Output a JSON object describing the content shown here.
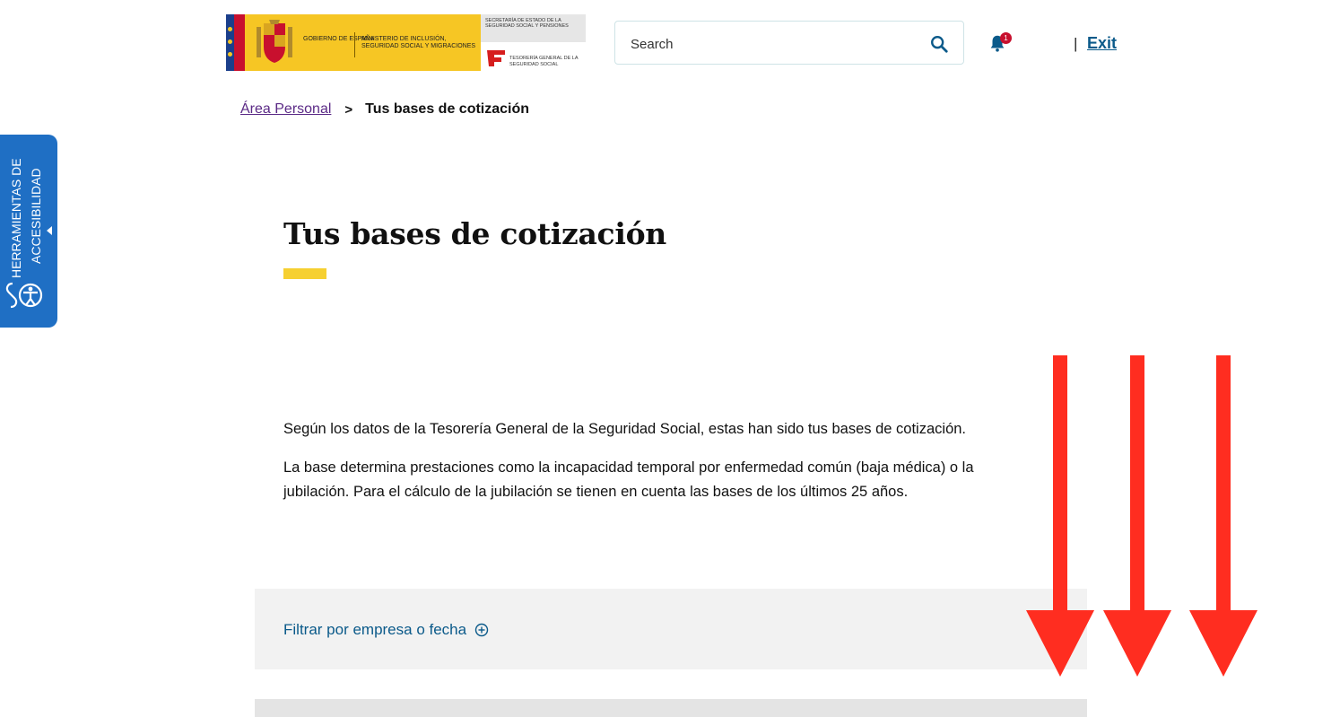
{
  "header": {
    "logo": {
      "gov_line": "Gobierno de España",
      "ministry_line": "Ministerio de Inclusión, Seguridad Social y Migraciones",
      "secretaria_line": "Secretaría de Estado de la Seguridad Social y Pensiones",
      "tgss_line": "Tesorería General de la Seguridad Social"
    },
    "search_placeholder": "Search",
    "notifications_count": "1",
    "separator": "|",
    "exit_label": "Exit"
  },
  "breadcrumb": {
    "parent": "Área Personal",
    "separator": ">",
    "current": "Tus bases de cotización"
  },
  "accessibility_tab": {
    "line1": "HERRAMIENTAS DE",
    "line2": "ACCESIBILIDAD"
  },
  "main": {
    "title": "Tus bases de cotización",
    "paragraph1": "Según los datos de la Tesorería General de la Seguridad Social, estas han sido tus bases de cotización.",
    "paragraph2": "La base determina prestaciones como la incapacidad temporal por enfermedad común (baja médica) o la jubilación. Para el cálculo de la jubilación se tienen en cuenta las bases de los últimos 25 años.",
    "filter_label": "Filtrar por empresa o fecha"
  },
  "colors": {
    "accent_yellow": "#f6d031",
    "link_blue": "#0b5a8a",
    "a11y_blue": "#1f6fc4",
    "arrow_red": "#ff2d20"
  }
}
